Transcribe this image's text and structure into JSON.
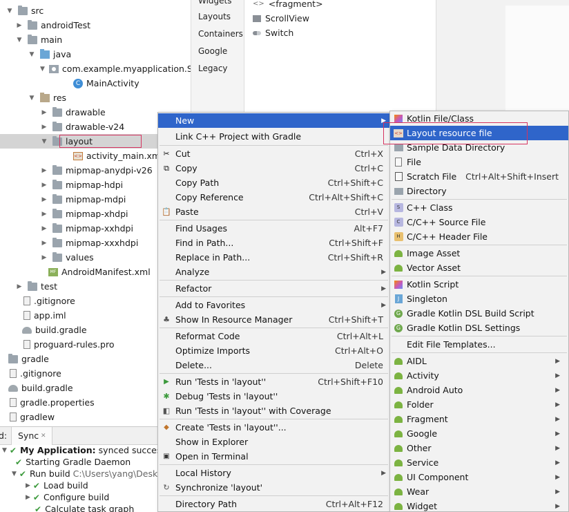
{
  "tree": {
    "items": [
      {
        "label": "src",
        "arrow": "▼",
        "icon": "folder"
      },
      {
        "label": "androidTest",
        "arrow": "▶",
        "icon": "folder"
      },
      {
        "label": "main",
        "arrow": "▼",
        "icon": "folder"
      },
      {
        "label": "java",
        "arrow": "▼",
        "icon": "java-folder"
      },
      {
        "label": "com.example.myapplication.Sm",
        "arrow": "▼",
        "icon": "package"
      },
      {
        "label": "MainActivity",
        "arrow": "",
        "icon": "class"
      },
      {
        "label": "res",
        "arrow": "▼",
        "icon": "res-folder"
      },
      {
        "label": "drawable",
        "arrow": "▶",
        "icon": "folder"
      },
      {
        "label": "drawable-v24",
        "arrow": "▶",
        "icon": "folder"
      },
      {
        "label": "layout",
        "arrow": "▼",
        "icon": "folder"
      },
      {
        "label": "activity_main.xml",
        "arrow": "",
        "icon": "xml"
      },
      {
        "label": "mipmap-anydpi-v26",
        "arrow": "▶",
        "icon": "folder"
      },
      {
        "label": "mipmap-hdpi",
        "arrow": "▶",
        "icon": "folder"
      },
      {
        "label": "mipmap-mdpi",
        "arrow": "▶",
        "icon": "folder"
      },
      {
        "label": "mipmap-xhdpi",
        "arrow": "▶",
        "icon": "folder"
      },
      {
        "label": "mipmap-xxhdpi",
        "arrow": "▶",
        "icon": "folder"
      },
      {
        "label": "mipmap-xxxhdpi",
        "arrow": "▶",
        "icon": "folder"
      },
      {
        "label": "values",
        "arrow": "▶",
        "icon": "folder"
      },
      {
        "label": "AndroidManifest.xml",
        "arrow": "",
        "icon": "manifest"
      },
      {
        "label": "test",
        "arrow": "▶",
        "icon": "folder"
      },
      {
        "label": ".gitignore",
        "arrow": "",
        "icon": "file"
      },
      {
        "label": "app.iml",
        "arrow": "",
        "icon": "file"
      },
      {
        "label": "build.gradle",
        "arrow": "",
        "icon": "gradle"
      },
      {
        "label": "proguard-rules.pro",
        "arrow": "",
        "icon": "file"
      },
      {
        "label": "gradle",
        "arrow": "",
        "icon": "folder"
      },
      {
        "label": ".gitignore",
        "arrow": "",
        "icon": "file"
      },
      {
        "label": "build.gradle",
        "arrow": "",
        "icon": "gradle"
      },
      {
        "label": "gradle.properties",
        "arrow": "",
        "icon": "file"
      },
      {
        "label": "gradlew",
        "arrow": "",
        "icon": "file"
      }
    ]
  },
  "palette": {
    "categories": [
      "Widgets",
      "Layouts",
      "Containers",
      "Google",
      "Legacy"
    ],
    "items": [
      {
        "label": "<fragment>",
        "icon": "fragment-icon"
      },
      {
        "label": "ScrollView",
        "icon": "scrollview-icon"
      },
      {
        "label": "Switch",
        "icon": "switch-icon"
      }
    ]
  },
  "build": {
    "tab_prefix": "d:",
    "tab_label": "Sync",
    "tab_close": "✕",
    "rows": [
      {
        "bold": "My Application:",
        "text": "synced successf",
        "gray": ""
      },
      {
        "bold": "",
        "text": "Starting Gradle Daemon",
        "gray": ""
      },
      {
        "bold": "",
        "text": "Run build",
        "gray": "C:\\Users\\yang\\Desk"
      },
      {
        "bold": "",
        "text": "Load build",
        "gray": ""
      },
      {
        "bold": "",
        "text": "Configure build",
        "gray": ""
      },
      {
        "bold": "",
        "text": "Calculate task graph",
        "gray": ""
      }
    ]
  },
  "context_menu": {
    "items": [
      {
        "label": "New",
        "shortcut": "",
        "submenu": true,
        "icon": ""
      },
      {
        "label": "Link C++ Project with Gradle",
        "shortcut": "",
        "submenu": false,
        "icon": ""
      },
      {
        "label": "Cut",
        "shortcut": "Ctrl+X",
        "submenu": false,
        "icon": "cut-icon"
      },
      {
        "label": "Copy",
        "shortcut": "Ctrl+C",
        "submenu": false,
        "icon": "copy-icon"
      },
      {
        "label": "Copy Path",
        "shortcut": "Ctrl+Shift+C",
        "submenu": false,
        "icon": ""
      },
      {
        "label": "Copy Reference",
        "shortcut": "Ctrl+Alt+Shift+C",
        "submenu": false,
        "icon": ""
      },
      {
        "label": "Paste",
        "shortcut": "Ctrl+V",
        "submenu": false,
        "icon": "paste-icon"
      },
      {
        "label": "Find Usages",
        "shortcut": "Alt+F7",
        "submenu": false,
        "icon": ""
      },
      {
        "label": "Find in Path...",
        "shortcut": "Ctrl+Shift+F",
        "submenu": false,
        "icon": ""
      },
      {
        "label": "Replace in Path...",
        "shortcut": "Ctrl+Shift+R",
        "submenu": false,
        "icon": ""
      },
      {
        "label": "Analyze",
        "shortcut": "",
        "submenu": true,
        "icon": ""
      },
      {
        "label": "Refactor",
        "shortcut": "",
        "submenu": true,
        "icon": ""
      },
      {
        "label": "Add to Favorites",
        "shortcut": "",
        "submenu": true,
        "icon": ""
      },
      {
        "label": "Show In Resource Manager",
        "shortcut": "Ctrl+Shift+T",
        "submenu": false,
        "icon": "resource-manager-icon"
      },
      {
        "label": "Reformat Code",
        "shortcut": "Ctrl+Alt+L",
        "submenu": false,
        "icon": ""
      },
      {
        "label": "Optimize Imports",
        "shortcut": "Ctrl+Alt+O",
        "submenu": false,
        "icon": ""
      },
      {
        "label": "Delete...",
        "shortcut": "Delete",
        "submenu": false,
        "icon": ""
      },
      {
        "label": "Run 'Tests in 'layout''",
        "shortcut": "Ctrl+Shift+F10",
        "submenu": false,
        "icon": "run-icon"
      },
      {
        "label": "Debug 'Tests in 'layout''",
        "shortcut": "",
        "submenu": false,
        "icon": "debug-icon"
      },
      {
        "label": "Run 'Tests in 'layout'' with Coverage",
        "shortcut": "",
        "submenu": false,
        "icon": "coverage-icon"
      },
      {
        "label": "Create 'Tests in 'layout''...",
        "shortcut": "",
        "submenu": false,
        "icon": "create-test-icon"
      },
      {
        "label": "Show in Explorer",
        "shortcut": "",
        "submenu": false,
        "icon": ""
      },
      {
        "label": "Open in Terminal",
        "shortcut": "",
        "submenu": false,
        "icon": "terminal-icon"
      },
      {
        "label": "Local History",
        "shortcut": "",
        "submenu": true,
        "icon": ""
      },
      {
        "label": "Synchronize 'layout'",
        "shortcut": "",
        "submenu": false,
        "icon": "sync-icon"
      },
      {
        "label": "Directory Path",
        "shortcut": "Ctrl+Alt+F12",
        "submenu": false,
        "icon": ""
      }
    ]
  },
  "new_submenu": {
    "items": [
      {
        "label": "Kotlin File/Class",
        "shortcut": "",
        "submenu": false,
        "icon": "kotlin"
      },
      {
        "label": "Layout resource file",
        "shortcut": "",
        "submenu": false,
        "icon": "layout"
      },
      {
        "label": "Sample Data Directory",
        "shortcut": "",
        "submenu": false,
        "icon": "folder"
      },
      {
        "label": "File",
        "shortcut": "",
        "submenu": false,
        "icon": "file"
      },
      {
        "label": "Scratch File",
        "shortcut": "Ctrl+Alt+Shift+Insert",
        "submenu": false,
        "icon": "scratch"
      },
      {
        "label": "Directory",
        "shortcut": "",
        "submenu": false,
        "icon": "folder"
      },
      {
        "label": "C++ Class",
        "shortcut": "",
        "submenu": false,
        "icon": "cpp-class"
      },
      {
        "label": "C/C++ Source File",
        "shortcut": "",
        "submenu": false,
        "icon": "cpp-source"
      },
      {
        "label": "C/C++ Header File",
        "shortcut": "",
        "submenu": false,
        "icon": "cpp-header"
      },
      {
        "label": "Image Asset",
        "shortcut": "",
        "submenu": false,
        "icon": "android"
      },
      {
        "label": "Vector Asset",
        "shortcut": "",
        "submenu": false,
        "icon": "android"
      },
      {
        "label": "Kotlin Script",
        "shortcut": "",
        "submenu": false,
        "icon": "kotlin"
      },
      {
        "label": "Singleton",
        "shortcut": "",
        "submenu": false,
        "icon": "java"
      },
      {
        "label": "Gradle Kotlin DSL Build Script",
        "shortcut": "",
        "submenu": false,
        "icon": "gradle"
      },
      {
        "label": "Gradle Kotlin DSL Settings",
        "shortcut": "",
        "submenu": false,
        "icon": "gradle"
      },
      {
        "label": "Edit File Templates...",
        "shortcut": "",
        "submenu": false,
        "icon": ""
      },
      {
        "label": "AIDL",
        "shortcut": "",
        "submenu": true,
        "icon": "android"
      },
      {
        "label": "Activity",
        "shortcut": "",
        "submenu": true,
        "icon": "android"
      },
      {
        "label": "Android Auto",
        "shortcut": "",
        "submenu": true,
        "icon": "android"
      },
      {
        "label": "Folder",
        "shortcut": "",
        "submenu": true,
        "icon": "android"
      },
      {
        "label": "Fragment",
        "shortcut": "",
        "submenu": true,
        "icon": "android"
      },
      {
        "label": "Google",
        "shortcut": "",
        "submenu": true,
        "icon": "android"
      },
      {
        "label": "Other",
        "shortcut": "",
        "submenu": true,
        "icon": "android"
      },
      {
        "label": "Service",
        "shortcut": "",
        "submenu": true,
        "icon": "android"
      },
      {
        "label": "UI Component",
        "shortcut": "",
        "submenu": true,
        "icon": "android"
      },
      {
        "label": "Wear",
        "shortcut": "",
        "submenu": true,
        "icon": "android"
      },
      {
        "label": "Widget",
        "shortcut": "",
        "submenu": true,
        "icon": "android"
      }
    ]
  },
  "colors": {
    "menu_highlight": "#2f65ca",
    "annotation_box": "#d5335f",
    "android_green": "#7cb342"
  }
}
